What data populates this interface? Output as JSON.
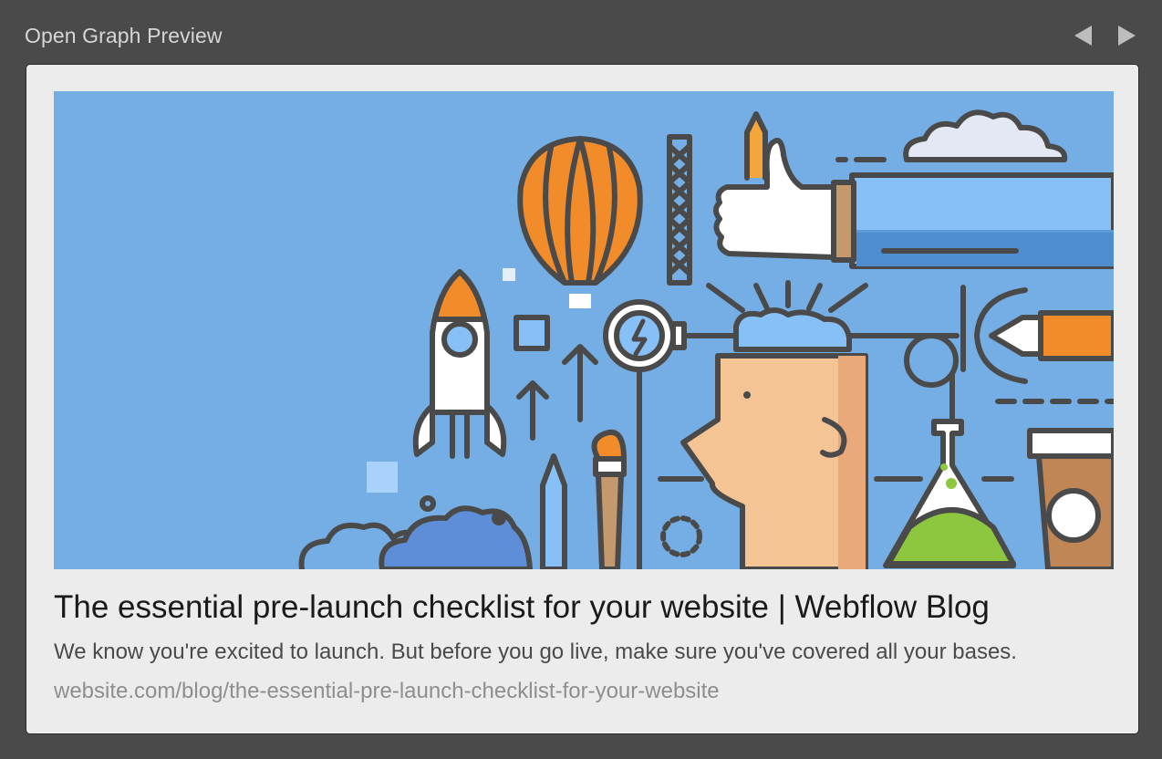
{
  "panel": {
    "title": "Open Graph Preview"
  },
  "nav": {
    "prev_icon": "triangle-left-icon",
    "next_icon": "triangle-right-icon",
    "icon_color": "#bdbdbd"
  },
  "preview": {
    "image_icon": "launch-illustration",
    "image_background": "#74aee5",
    "title": "The essential pre-launch checklist for your website | Webflow Blog",
    "description": "We know you're excited to launch. But before you go live, make sure you've covered all your bases.",
    "url": "website.com/blog/the-essential-pre-launch-checklist-for-your-website"
  }
}
